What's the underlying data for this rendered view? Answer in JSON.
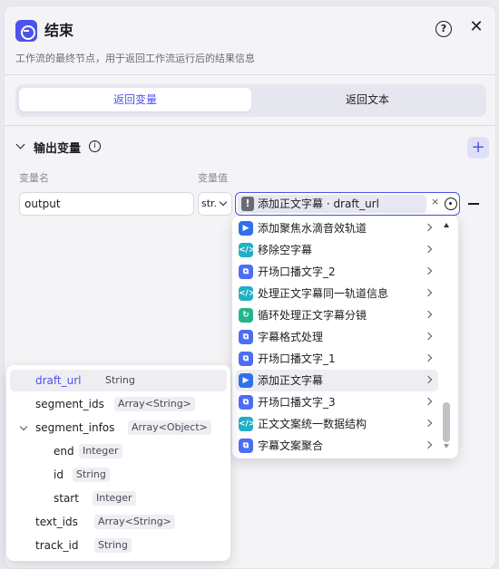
{
  "header": {
    "title": "结束",
    "description": "工作流的最终节点，用于返回工作流运行后的结果信息",
    "help_glyph": "?",
    "close_glyph": "✕"
  },
  "tabs": [
    {
      "label": "返回变量",
      "active": true
    },
    {
      "label": "返回文本",
      "active": false
    }
  ],
  "section": {
    "title": "输出变量",
    "info_glyph": "i",
    "add_glyph": "+",
    "col_name": "变量名",
    "col_value": "变量值"
  },
  "row": {
    "name": "output",
    "type_abbrev": "str.",
    "ref_label": "添加正文字幕 · draft_url",
    "clear_glyph": "×",
    "warn_glyph": "!"
  },
  "dropdown": {
    "items": [
      {
        "label": "添加聚焦水滴音效轨道",
        "icon": "plugin-icon",
        "color": "#2f6ff0",
        "glyph": "▶"
      },
      {
        "label": "移除空字幕",
        "icon": "code-icon",
        "color": "#1fb0c6",
        "glyph": "</>"
      },
      {
        "label": "开场口播文字_2",
        "icon": "workflow-icon",
        "color": "#4b6ef5",
        "glyph": "⧉"
      },
      {
        "label": "处理正文字幕同一轨道信息",
        "icon": "code-icon",
        "color": "#1fb0c6",
        "glyph": "</>"
      },
      {
        "label": "循环处理正文字幕分镜",
        "icon": "loop-icon",
        "color": "#21b58c",
        "glyph": "↻"
      },
      {
        "label": "字幕格式处理",
        "icon": "workflow-icon",
        "color": "#4b6ef5",
        "glyph": "⧉"
      },
      {
        "label": "开场口播文字_1",
        "icon": "workflow-icon",
        "color": "#4b6ef5",
        "glyph": "⧉"
      },
      {
        "label": "添加正文字幕",
        "icon": "plugin-icon",
        "color": "#2f6ff0",
        "glyph": "▶",
        "highlighted": true
      },
      {
        "label": "开场口播文字_3",
        "icon": "workflow-icon",
        "color": "#4b6ef5",
        "glyph": "⧉"
      },
      {
        "label": "正文文案统一数据结构",
        "icon": "code-icon",
        "color": "#1fb0c6",
        "glyph": "</>"
      },
      {
        "label": "字幕文案聚合",
        "icon": "workflow-icon",
        "color": "#4b6ef5",
        "glyph": "⧉"
      }
    ]
  },
  "variables": [
    {
      "name": "draft_url",
      "type": "String",
      "level": 0,
      "selected": true
    },
    {
      "name": "segment_ids",
      "type": "Array<String>",
      "level": 0
    },
    {
      "name": "segment_infos",
      "type": "Array<Object>",
      "level": 0,
      "expanded": true
    },
    {
      "name": "end",
      "type": "Integer",
      "level": 1
    },
    {
      "name": "id",
      "type": "String",
      "level": 1
    },
    {
      "name": "start",
      "type": "Integer",
      "level": 1
    },
    {
      "name": "text_ids",
      "type": "Array<String>",
      "level": 0
    },
    {
      "name": "track_id",
      "type": "String",
      "level": 0
    }
  ]
}
